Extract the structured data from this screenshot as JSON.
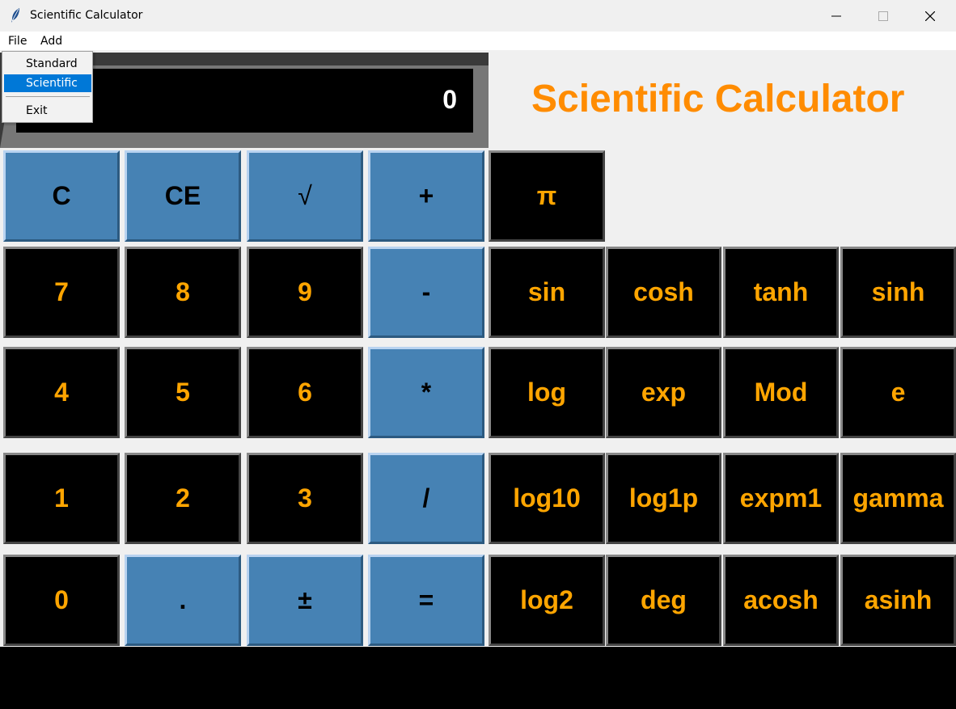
{
  "window": {
    "title": "Scientific Calculator"
  },
  "menubar": {
    "file": "File",
    "add": "Add"
  },
  "dropdown": {
    "standard": "Standard",
    "scientific": "Scientific",
    "exit": "Exit"
  },
  "display": {
    "value": "0"
  },
  "heading": "Scientific Calculator",
  "buttons": {
    "c": "C",
    "ce": "CE",
    "sqrt": "√",
    "plus": "+",
    "pi": "π",
    "seven": "7",
    "eight": "8",
    "nine": "9",
    "minus": "-",
    "sin": "sin",
    "cosh": "cosh",
    "tanh": "tanh",
    "sinh": "sinh",
    "four": "4",
    "five": "5",
    "six": "6",
    "multiply": "*",
    "log": "log",
    "exp": "exp",
    "mod": "Mod",
    "e": "e",
    "one": "1",
    "two": "2",
    "three": "3",
    "divide": "/",
    "log10": "log10",
    "log1p": "log1p",
    "expm1": "expm1",
    "gamma": "gamma",
    "zero": "0",
    "dot": ".",
    "plusminus": "±",
    "equals": "=",
    "log2": "log2",
    "deg": "deg",
    "acosh": "acosh",
    "asinh": "asinh"
  },
  "colors": {
    "accent": "#ff8c00",
    "digit": "#ffa500",
    "operator_bg": "#4682b4",
    "key_bg": "#000000",
    "menu_highlight": "#0078d7"
  }
}
